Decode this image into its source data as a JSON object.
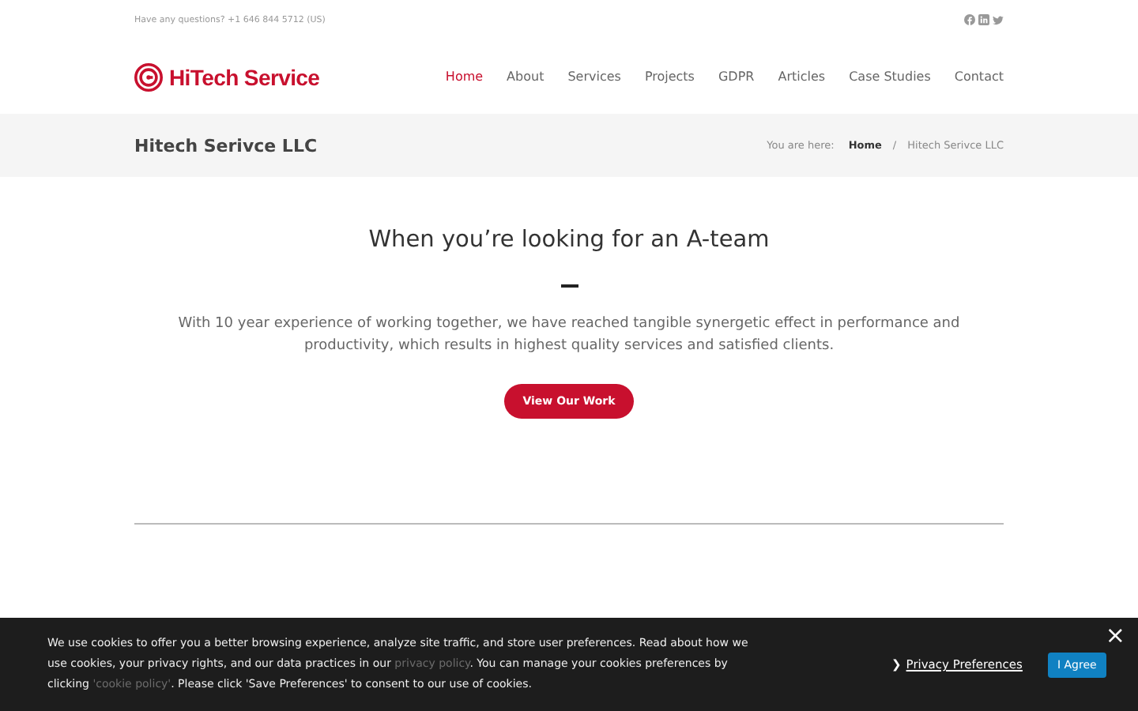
{
  "topbar": {
    "contact": "Have any questions? +1 646 844 5712 (US)"
  },
  "header": {
    "logo_text": "HiTech Service",
    "nav": [
      {
        "label": "Home",
        "selected": true
      },
      {
        "label": "About",
        "selected": false
      },
      {
        "label": "Services",
        "selected": false
      },
      {
        "label": "Projects",
        "selected": false
      },
      {
        "label": "GDPR",
        "selected": false
      },
      {
        "label": "Articles",
        "selected": false
      },
      {
        "label": "Case Studies",
        "selected": false
      },
      {
        "label": "Contact",
        "selected": false
      }
    ]
  },
  "page_title": {
    "title": "Hitech Serivce LLC",
    "breadcrumb_prefix": "You are here:",
    "breadcrumbs": [
      "Home",
      "Hitech Serivce LLC"
    ],
    "separator": "/"
  },
  "intro": {
    "heading": "When you’re looking for an A-team",
    "text": "With 10 year experience of working together, we have reached tangible synergetic effect in performance and productivity, which results in highest quality services and satisfied clients.",
    "button": "View Our Work"
  },
  "cookie_bar": {
    "text": "We use cookies to offer you a better browsing experience, analyze site traffic, and store user preferences. Read about how we use cookies, your privacy rights, and our data practices in our ",
    "link1": "privacy policy",
    "text2": ". You can manage your cookies preferences by clicking ",
    "link2": "'cookie policy'",
    "text3": ". Please click 'Save Preferences' to consent to our use of cookies.",
    "caret": "❯",
    "preferences": "Privacy Preferences",
    "agree": "I Agree",
    "close": "×"
  }
}
